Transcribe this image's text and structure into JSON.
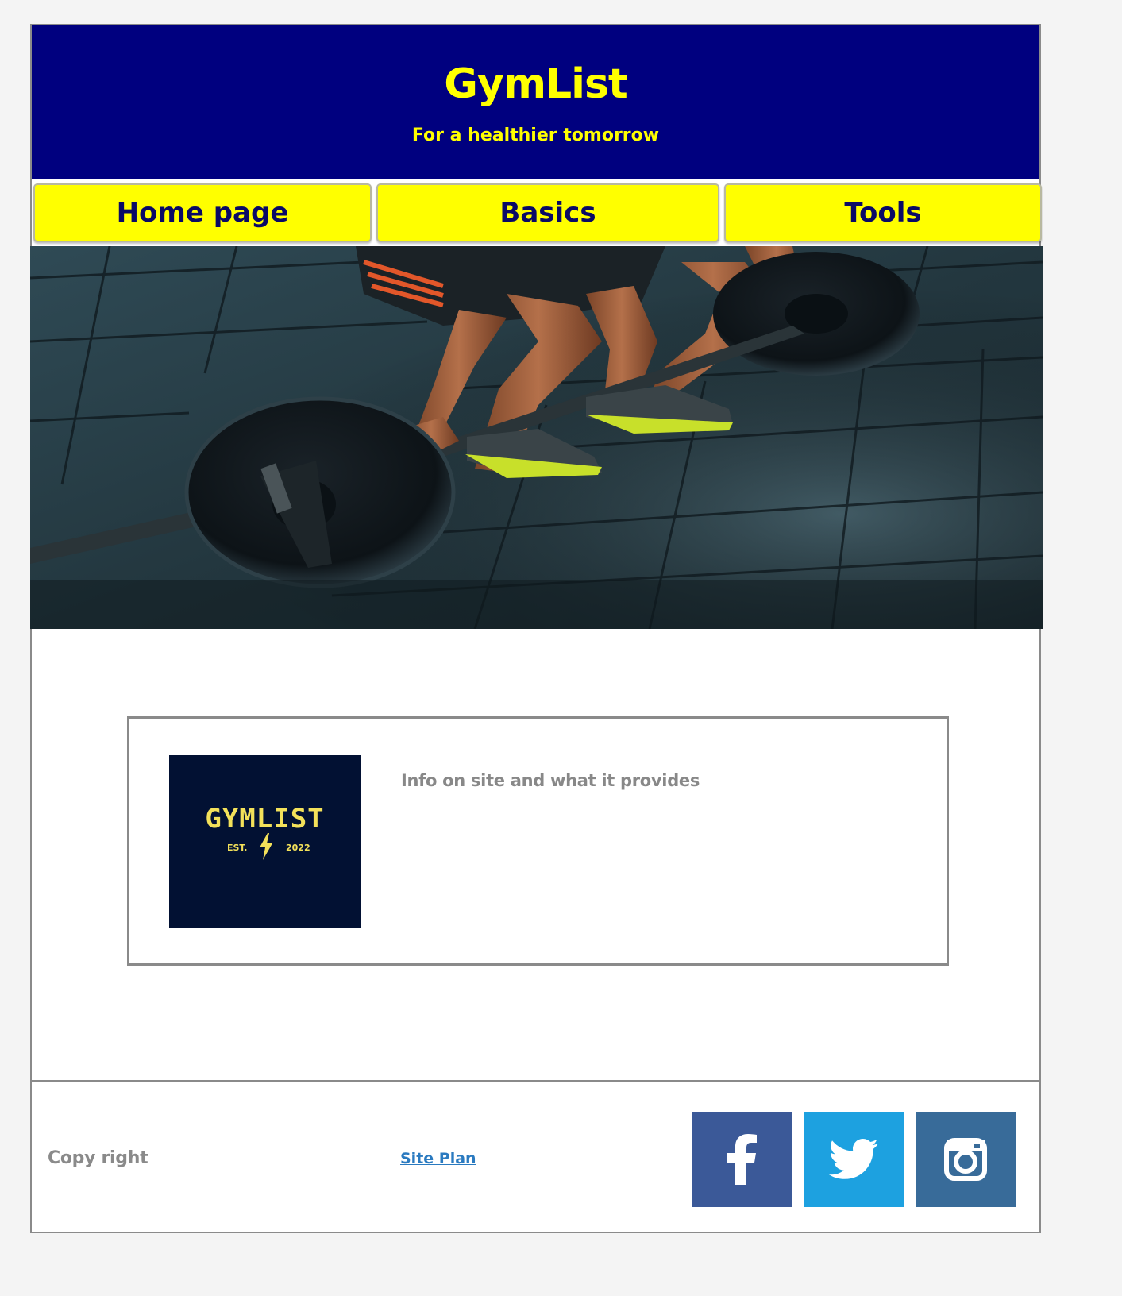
{
  "header": {
    "title": "GymList",
    "tagline": "For a healthier tomorrow",
    "background_color": "#00007f",
    "text_color": "#ffff00"
  },
  "nav": {
    "items": [
      {
        "label": "Home page"
      },
      {
        "label": "Basics"
      },
      {
        "label": "Tools"
      }
    ],
    "button_color": "#ffff00",
    "text_color": "#0a0a66"
  },
  "hero": {
    "image": "photo of a person gripping a loaded barbell on a gym floor"
  },
  "info": {
    "logo": {
      "wordmark": "GYMLIST",
      "est": "EST.",
      "year": "2022",
      "icon": "lightning-bolt-icon"
    },
    "text": "Info on site and what it provides"
  },
  "footer": {
    "copyright": "Copy right",
    "site_plan_link": "Site Plan",
    "social": [
      {
        "name": "facebook",
        "icon": "facebook-icon",
        "color": "#3b5998"
      },
      {
        "name": "twitter",
        "icon": "twitter-icon",
        "color": "#1da1e0"
      },
      {
        "name": "instagram",
        "icon": "instagram-icon",
        "color": "#386b99"
      }
    ]
  }
}
